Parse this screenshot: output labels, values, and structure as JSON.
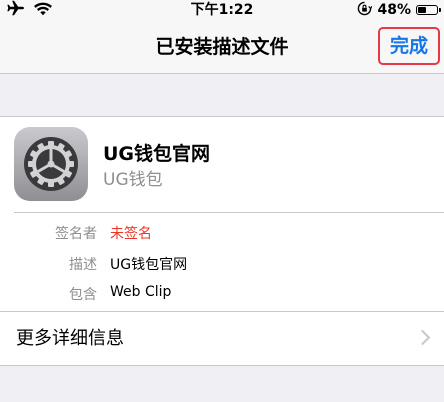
{
  "status_bar": {
    "time": "下午1:22",
    "battery_percent": "48%",
    "battery_level": 0.48,
    "icons": [
      "airplane-icon",
      "wifi-icon",
      "orientation-lock-icon",
      "battery-icon"
    ]
  },
  "nav": {
    "title": "已安装描述文件",
    "done_label": "完成",
    "done_color": "#1676e8",
    "highlight_color": "#e63946"
  },
  "profile": {
    "name": "UG钱包官网",
    "subtitle": "UG钱包",
    "icon": "settings-gear-icon",
    "details": [
      {
        "label": "签名者",
        "value": "未签名",
        "value_color": "#e8362a"
      },
      {
        "label": "描述",
        "value": "UG钱包官网"
      },
      {
        "label": "包含",
        "value": "Web Clip"
      }
    ]
  },
  "more": {
    "label": "更多详细信息"
  }
}
